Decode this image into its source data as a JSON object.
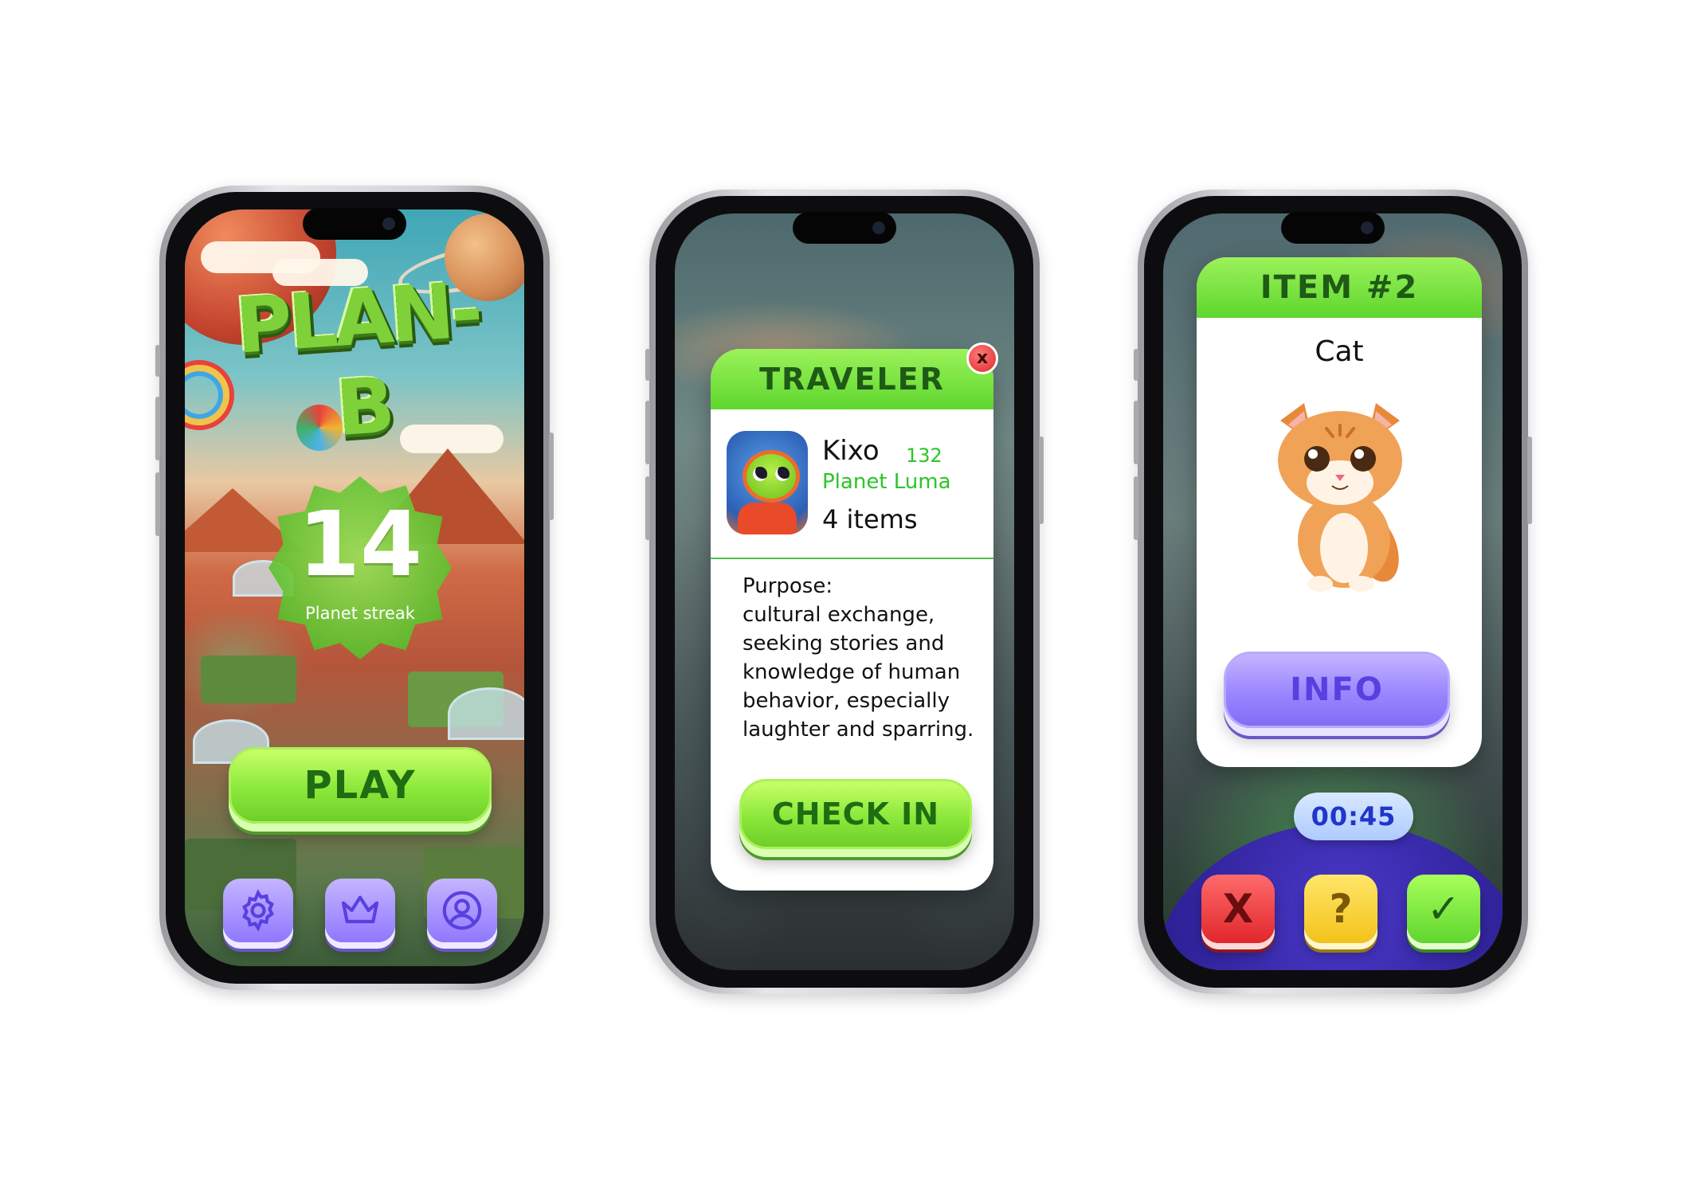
{
  "home": {
    "logo": "PLAN-B",
    "streak_value": "14",
    "streak_label": "Planet streak",
    "play_label": "PLAY",
    "icons": [
      "gear-icon",
      "crown-icon",
      "profile-icon"
    ]
  },
  "traveler": {
    "title": "TRAVELER",
    "close_label": "x",
    "name": "Kixo",
    "number": "132",
    "planet": "Planet Luma",
    "items": "4 items",
    "purpose_heading": "Purpose:",
    "purpose_text": "cultural exchange, seeking stories and knowledge of human behavior, especially laughter and sparring.",
    "checkin_label": "CHECK IN"
  },
  "item": {
    "title": "ITEM #2",
    "name": "Cat",
    "info_label": "INFO",
    "timer": "00:45",
    "reject_label": "X",
    "unsure_label": "?",
    "accept_label": "✓"
  },
  "colors": {
    "green_accent": "#6fcf2a",
    "purple_accent": "#8f78ff",
    "red_button": "#e0262b",
    "yellow_button": "#f3c21a",
    "timer_text": "#1f36c8"
  }
}
